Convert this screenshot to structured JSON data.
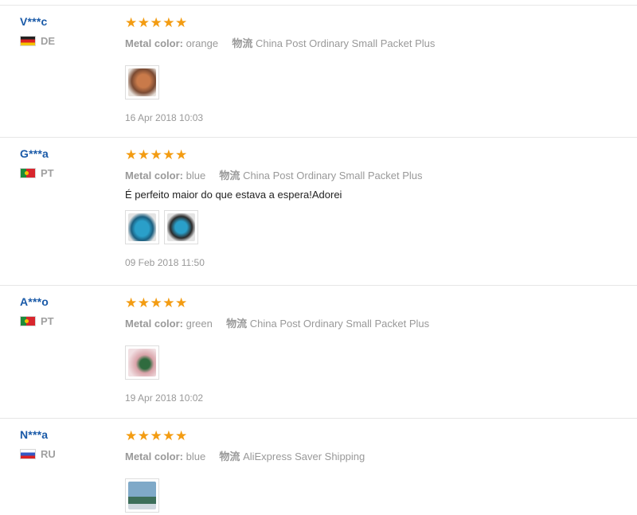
{
  "reviews": [
    {
      "user": "V***c",
      "flag": "de",
      "country": "DE",
      "stars": "★★★★★",
      "rating": 5,
      "color_label": "Metal color:",
      "color_value": "orange",
      "logistics_label": "物流",
      "logistics_value": "China Post Ordinary Small Packet Plus",
      "comment": "",
      "photos": [
        "review-photo-orange-stone"
      ],
      "date": "16 Apr 2018 10:03"
    },
    {
      "user": "G***a",
      "flag": "pt",
      "country": "PT",
      "stars": "★★★★★",
      "rating": 5,
      "color_label": "Metal color:",
      "color_value": "blue",
      "logistics_label": "物流",
      "logistics_value": "China Post Ordinary Small Packet Plus",
      "comment": "É perfeito maior do que estava a espera!Adorei",
      "photos": [
        "review-photo-blue-stone-1",
        "review-photo-blue-stone-2"
      ],
      "date": "09 Feb 2018 11:50"
    },
    {
      "user": "A***o",
      "flag": "pt",
      "country": "PT",
      "stars": "★★★★★",
      "rating": 5,
      "color_label": "Metal color:",
      "color_value": "green",
      "logistics_label": "物流",
      "logistics_value": "China Post Ordinary Small Packet Plus",
      "comment": "",
      "photos": [
        "review-photo-green-stone"
      ],
      "date": "19 Apr 2018 10:02"
    },
    {
      "user": "N***a",
      "flag": "ru",
      "country": "RU",
      "stars": "★★★★★",
      "rating": 5,
      "color_label": "Metal color:",
      "color_value": "blue",
      "logistics_label": "物流",
      "logistics_value": "AliExpress Saver Shipping",
      "comment": "",
      "photos": [
        "review-photo-blue-stone-3"
      ],
      "date": ""
    }
  ],
  "colors": {
    "user_name": "#1a5aa8",
    "star": "#f39c12",
    "muted": "#999999",
    "divider": "#e6e6e6"
  }
}
